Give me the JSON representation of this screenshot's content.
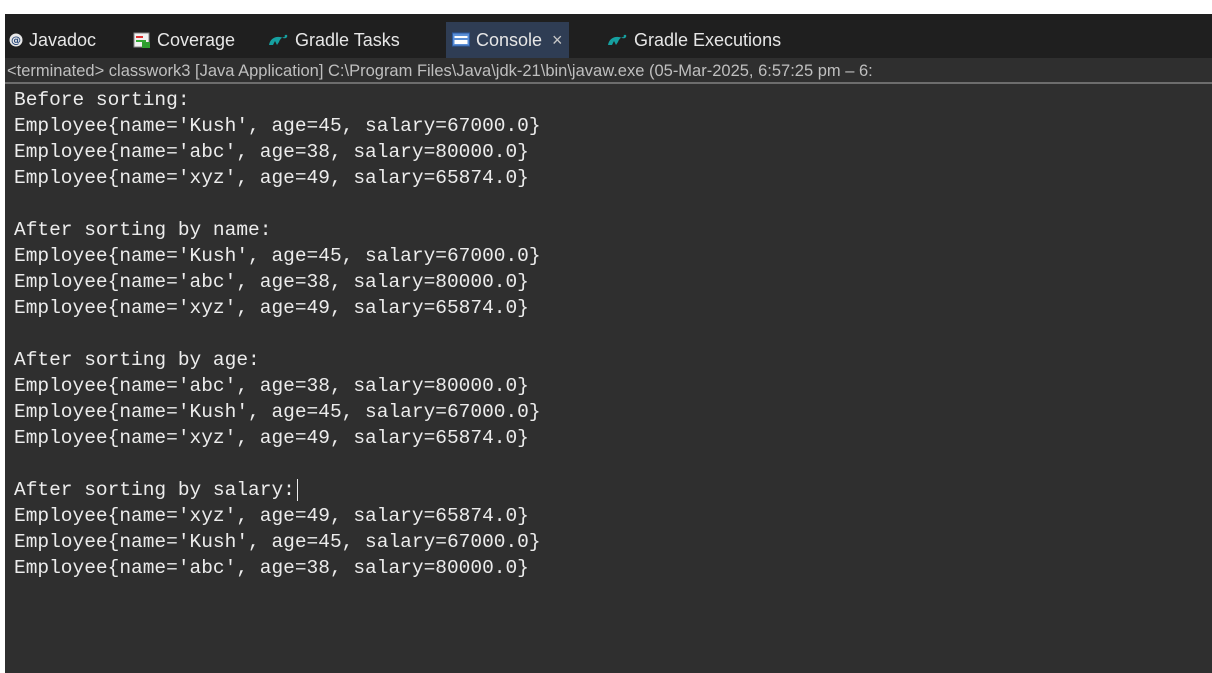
{
  "tabs": [
    {
      "label": "Javadoc",
      "icon": "at-icon",
      "active": false
    },
    {
      "label": "Coverage",
      "icon": "coverage-icon",
      "active": false
    },
    {
      "label": "Gradle Tasks",
      "icon": "gradle-icon",
      "active": false
    },
    {
      "label": "Console",
      "icon": "console-icon",
      "active": true,
      "close": "×"
    },
    {
      "label": "Gradle Executions",
      "icon": "gradle-icon",
      "active": false
    }
  ],
  "status_line": "<terminated> classwork3 [Java Application] C:\\Program Files\\Java\\jdk-21\\bin\\javaw.exe  (05-Mar-2025, 6:57:25 pm – 6:",
  "console_lines": [
    "Before sorting:",
    "Employee{name='Kush', age=45, salary=67000.0}",
    "Employee{name='abc', age=38, salary=80000.0}",
    "Employee{name='xyz', age=49, salary=65874.0}",
    "",
    "After sorting by name:",
    "Employee{name='Kush', age=45, salary=67000.0}",
    "Employee{name='abc', age=38, salary=80000.0}",
    "Employee{name='xyz', age=49, salary=65874.0}",
    "",
    "After sorting by age:",
    "Employee{name='abc', age=38, salary=80000.0}",
    "Employee{name='Kush', age=45, salary=67000.0}",
    "Employee{name='xyz', age=49, salary=65874.0}",
    "",
    "After sorting by salary:",
    "Employee{name='xyz', age=49, salary=65874.0}",
    "Employee{name='Kush', age=45, salary=67000.0}",
    "Employee{name='abc', age=38, salary=80000.0}"
  ],
  "colors": {
    "console_bg": "#2f2f2f",
    "tabbar_bg": "#1f1f1f",
    "active_tab_bg": "#2f3d54",
    "text": "#ececec"
  }
}
